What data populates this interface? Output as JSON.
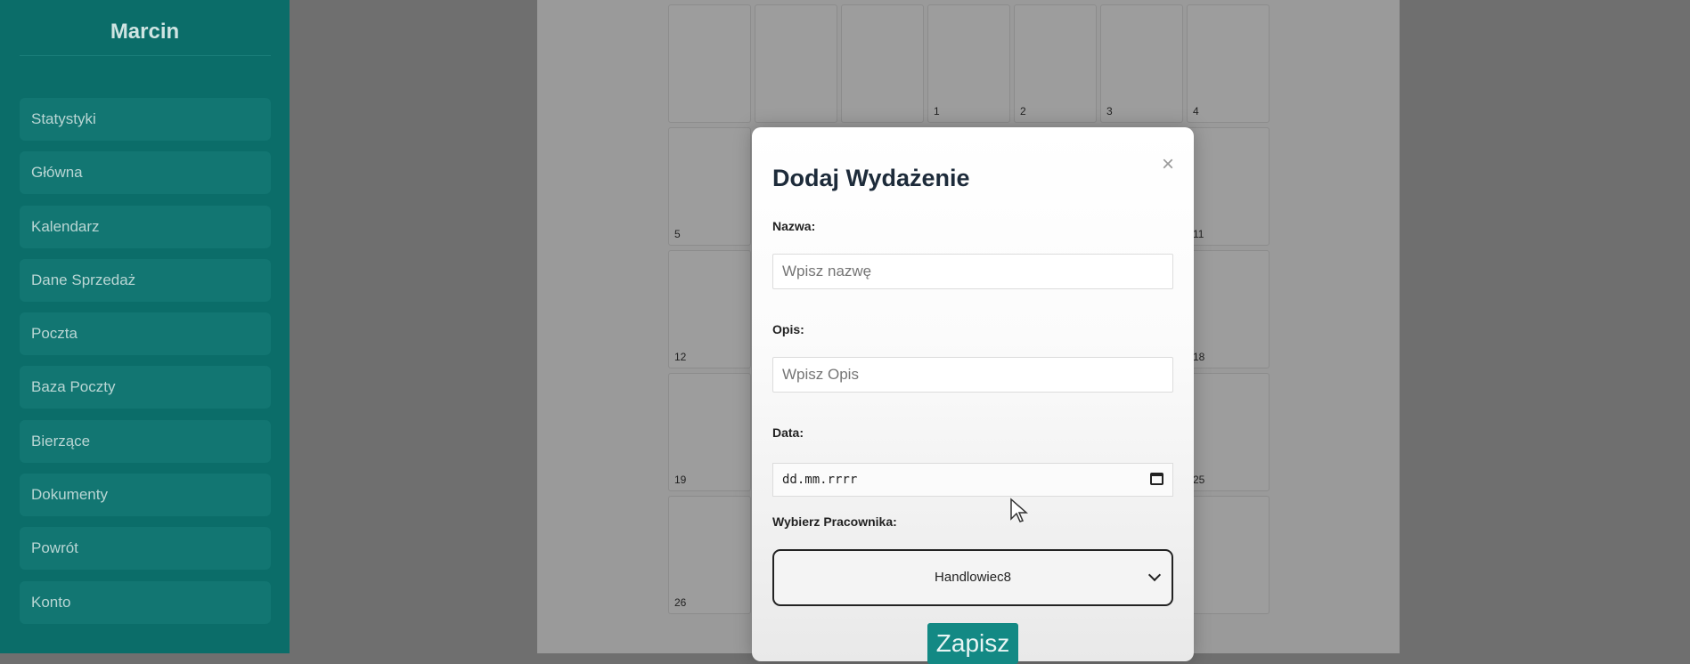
{
  "sidebar": {
    "user": "Marcin",
    "items": [
      {
        "label": "Statystyki"
      },
      {
        "label": "Główna"
      },
      {
        "label": "Kalendarz"
      },
      {
        "label": "Dane Sprzedaż"
      },
      {
        "label": "Poczta"
      },
      {
        "label": "Baza Poczty"
      },
      {
        "label": "Bierzące"
      },
      {
        "label": "Dokumenty"
      },
      {
        "label": "Powrót"
      },
      {
        "label": "Konto"
      }
    ]
  },
  "calendar": {
    "days": [
      "1",
      "2",
      "3",
      "4",
      "5",
      "11",
      "12",
      "18",
      "19",
      "25",
      "26"
    ]
  },
  "modal": {
    "title": "Dodaj Wydażenie",
    "close_symbol": "×",
    "name_label": "Nazwa:",
    "name_placeholder": "Wpisz nazwę",
    "desc_label": "Opis:",
    "desc_placeholder": "Wpisz Opis",
    "date_label": "Data:",
    "date_placeholder": "dd.mm.rrrr",
    "employee_label": "Wybierz Pracownika:",
    "employee_selected": "Handlowiec8",
    "save_label": "Zapisz"
  },
  "colors": {
    "sidebar": "#0b6d69",
    "accent": "#138984"
  }
}
